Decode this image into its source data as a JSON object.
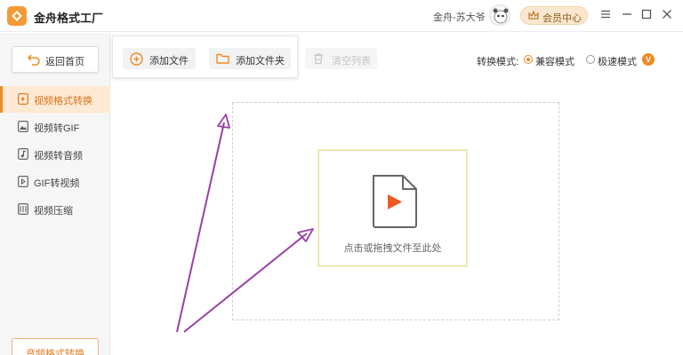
{
  "app": {
    "title": "金舟格式工厂",
    "user_name": "金舟-苏大爷",
    "vip_label": "会员中心"
  },
  "window_controls": {
    "menu_icon": "hamburger-icon",
    "minimize_icon": "minimize-icon",
    "maximize_icon": "maximize-icon",
    "close_icon": "close-icon"
  },
  "sidebar": {
    "home_label": "返回首页",
    "items": [
      {
        "label": "视频格式转换",
        "icon": "video-convert-icon",
        "active": true
      },
      {
        "label": "视频转GIF",
        "icon": "image-icon",
        "active": false
      },
      {
        "label": "视频转音频",
        "icon": "music-note-icon",
        "active": false
      },
      {
        "label": "GIF转视频",
        "icon": "gif-video-icon",
        "active": false
      },
      {
        "label": "视频压缩",
        "icon": "compress-icon",
        "active": false
      }
    ],
    "bottom_label": "音频格式转换"
  },
  "toolbar": {
    "add_file": "添加文件",
    "add_folder": "添加文件夹",
    "clear_list": "清空列表",
    "mode_label": "转换模式:",
    "mode_options": [
      {
        "label": "兼容模式",
        "checked": true
      },
      {
        "label": "极速模式",
        "checked": false
      }
    ],
    "vip_badge": "V"
  },
  "dropzone": {
    "text": "点击或拖拽文件至此处"
  },
  "colors": {
    "accent": "#f08a24",
    "active_bg": "#fde9d4",
    "annotation_arrow": "#9b3fa8"
  }
}
